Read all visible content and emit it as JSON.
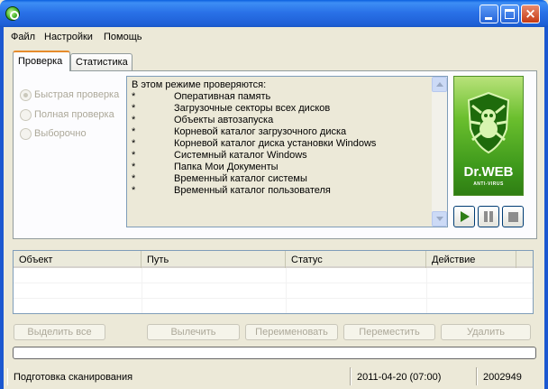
{
  "window": {
    "title": ""
  },
  "menu": [
    "Файл",
    "Настройки",
    "Помощь"
  ],
  "tabs": [
    {
      "label": "Проверка",
      "active": true
    },
    {
      "label": "Статистика",
      "active": false
    }
  ],
  "scan_modes": [
    {
      "label": "Быстрая проверка",
      "selected": true,
      "enabled": false
    },
    {
      "label": "Полная проверка",
      "selected": false,
      "enabled": false
    },
    {
      "label": "Выборочно",
      "selected": false,
      "enabled": false
    }
  ],
  "info": {
    "heading": "В этом режиме проверяются:",
    "bullet": "*",
    "items": [
      "Оперативная память",
      "Загрузочные секторы всех дисков",
      "Объекты автозапуска",
      "Корневой каталог загрузочного диска",
      "Корневой каталог диска установки Windows",
      "Системный каталог Windows",
      "Папка Мои Документы",
      "Временный каталог системы",
      "Временный каталог пользователя"
    ]
  },
  "logo": {
    "brand": "Dr.WEB",
    "tagline": "ANTI-VIRUS"
  },
  "controls": {
    "play": "play-icon",
    "pause": "pause-icon",
    "stop": "stop-icon"
  },
  "table": {
    "columns": [
      "Объект",
      "Путь",
      "Статус",
      "Действие"
    ],
    "rows": []
  },
  "actions": {
    "select_all": "Выделить все",
    "cure": "Вылечить",
    "rename": "Переименовать",
    "move": "Переместить",
    "delete": "Удалить"
  },
  "progress": {
    "value": 0.0
  },
  "status": {
    "text": "Подготовка сканирования",
    "datetime": "2011-04-20 (07:00)",
    "count": "2002949"
  },
  "colors": {
    "titlebar": "#2a72e8",
    "tab_accent": "#e68b2c",
    "logo_green": "#3f9a1c",
    "play_green": "#2e7d16"
  }
}
